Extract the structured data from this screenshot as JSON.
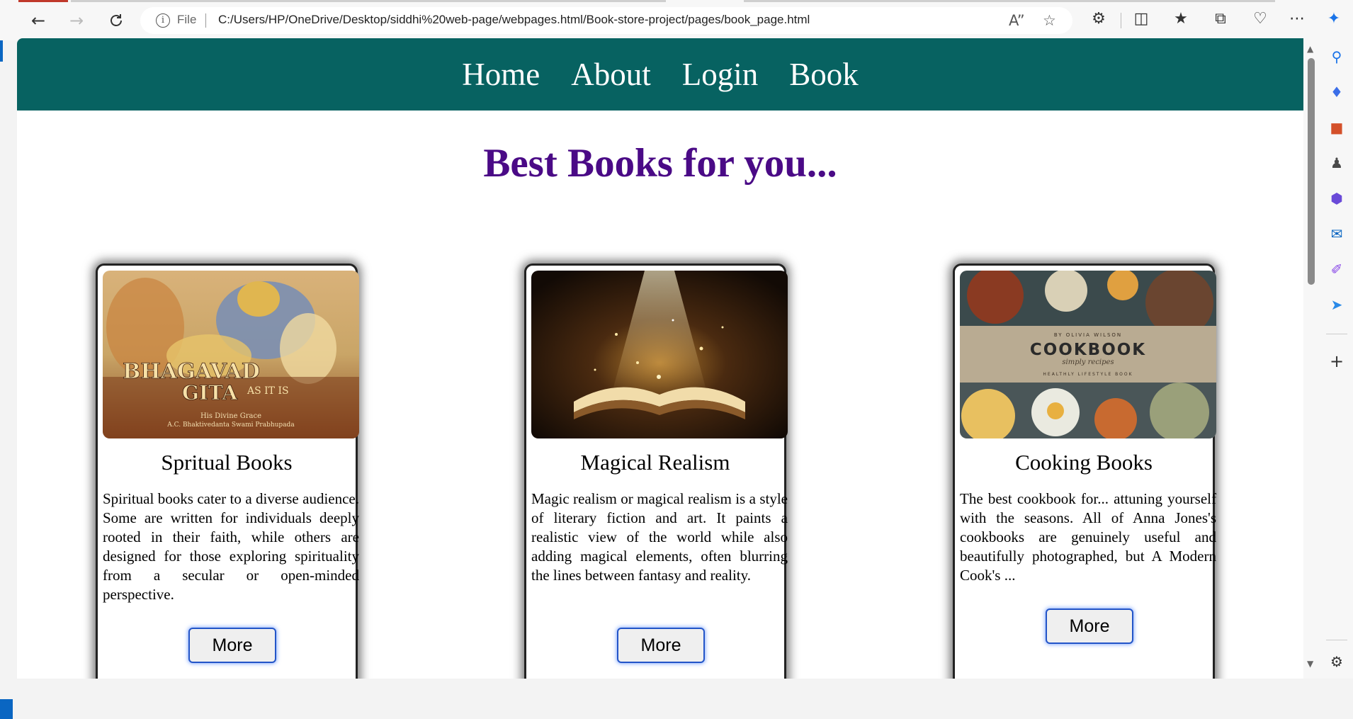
{
  "browser": {
    "address": {
      "prefix": "File",
      "url": "C:/Users/HP/OneDrive/Desktop/siddhi%20web-page/webpages.html/Book-store-project/pages/book_page.html"
    }
  },
  "nav": {
    "items": [
      "Home",
      "About",
      "Login",
      "Book"
    ]
  },
  "heading": "Best Books for you...",
  "cards": [
    {
      "title": "Spritual Books",
      "text": "Spiritual books cater to a diverse audience. Some are written for individuals deeply rooted in their faith, while others are designed for those exploring spirituality from a secular or open-minded perspective.",
      "button": "More",
      "cover": {
        "title_line1": "BHAGAVAD",
        "title_line2": "GITA",
        "title_suffix": "AS IT IS",
        "byline1": "His Divine Grace",
        "byline2": "A.C. Bhaktivedanta Swami Prabhupada"
      }
    },
    {
      "title": "Magical Realism",
      "text": "Magic realism or magical realism is a style of literary fiction and art. It paints a realistic view of the world while also adding magical elements, often blurring the lines between fantasy and reality.",
      "button": "More"
    },
    {
      "title": "Cooking Books",
      "text": "The best cookbook for... attuning yourself with the seasons. All of Anna Jones's cookbooks are genuinely useful and beautifully photographed, but A Modern Cook's ...",
      "button": "More",
      "cover": {
        "author": "BY OLIVIA WILSON",
        "title": "COOKBOOK",
        "subtitle": "simply recipes",
        "tagline": "HEALTHLY LIFESTYLE BOOK"
      }
    }
  ],
  "colors": {
    "nav_bg": "#076261",
    "heading": "#4a0a86",
    "button_border": "#2355c8"
  },
  "icons": {
    "back": "arrow-left-icon",
    "forward": "arrow-right-icon",
    "refresh": "refresh-icon",
    "info": "info-icon",
    "read_aloud": "read-aloud-icon",
    "favorite": "star-icon",
    "extensions": "puzzle-icon",
    "split": "split-screen-icon",
    "favorites": "favorites-icon",
    "collections": "collections-icon",
    "performance": "heart-pulse-icon",
    "menu": "more-icon",
    "copilot": "copilot-icon"
  }
}
